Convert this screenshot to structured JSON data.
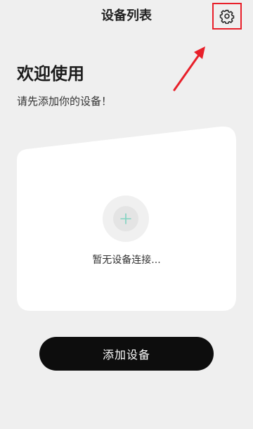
{
  "header": {
    "title": "设备列表",
    "settings_icon": "gear-icon",
    "highlight_color": "#e8202a"
  },
  "welcome": {
    "title": "欢迎使用",
    "subtitle": "请先添加你的设备！"
  },
  "device_card": {
    "add_icon": "plus-icon",
    "empty_text": "暂无设备连接..."
  },
  "actions": {
    "add_device_label": "添加设备"
  },
  "colors": {
    "background": "#efefef",
    "card": "#ffffff",
    "primary_button": "#0d0d0d",
    "plus_accent": "#7fd3c0"
  }
}
